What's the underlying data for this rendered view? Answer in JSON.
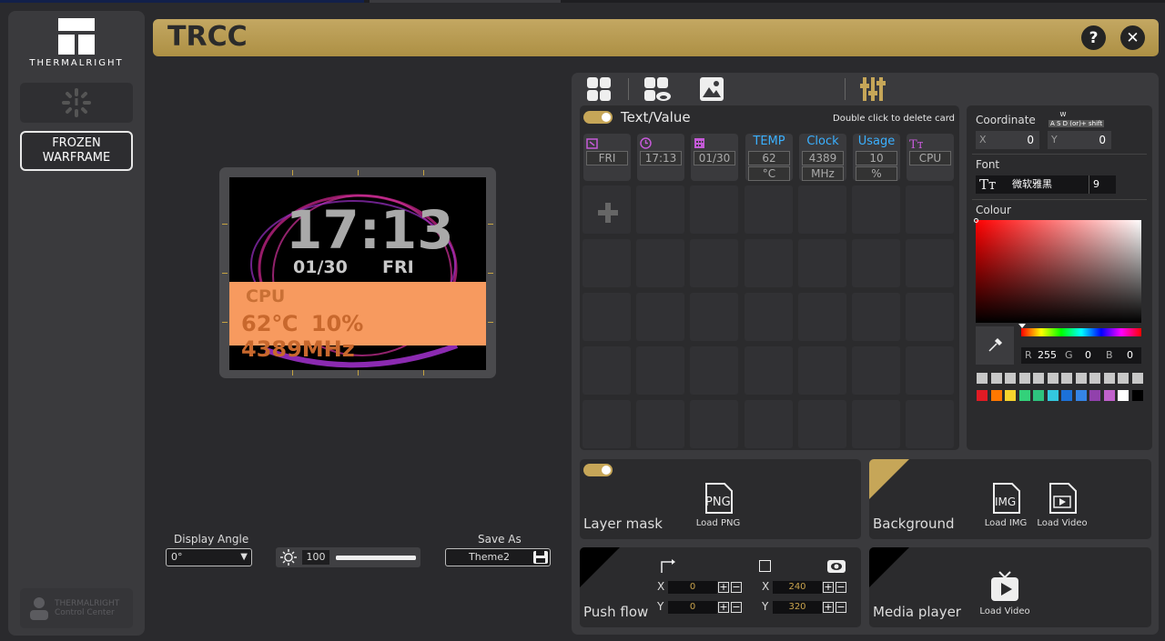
{
  "brand": {
    "name": "THERMALRIGHT"
  },
  "sidebar": {
    "device_button": "FROZEN\nWARFRAME",
    "control_center": {
      "line1": "THERMALRIGHT",
      "line2": "Control Center"
    }
  },
  "header": {
    "title": "TRCC",
    "help": "?",
    "close": "✕"
  },
  "preview": {
    "time": "17:13",
    "date": "01/30",
    "day": "FRI",
    "cpu_label": "CPU",
    "cpu_values": "62℃ 10% 4389MHz"
  },
  "controls": {
    "display_angle_label": "Display Angle",
    "display_angle_value": "0°",
    "brightness": "100",
    "brightness_level": 1.0,
    "save_as_label": "Save As",
    "save_as_value": "Theme2"
  },
  "cards_panel": {
    "title": "Text/Value",
    "hint": "Double click to delete card",
    "cards": [
      {
        "icon": "calendar-day-icon",
        "head": "",
        "value": "FRI",
        "unit": ""
      },
      {
        "icon": "clock-icon",
        "head": "",
        "value": "17:13",
        "unit": ""
      },
      {
        "icon": "calendar-grid-icon",
        "head": "",
        "value": "01/30",
        "unit": ""
      },
      {
        "icon": "",
        "head": "TEMP",
        "value": "62",
        "unit": "°C"
      },
      {
        "icon": "",
        "head": "Clock",
        "value": "4389",
        "unit": "MHz"
      },
      {
        "icon": "",
        "head": "Usage",
        "value": "10",
        "unit": "%"
      },
      {
        "icon": "text-icon",
        "head": "",
        "value": "CPU",
        "unit": ""
      }
    ]
  },
  "properties": {
    "coordinate_label": "Coordinate",
    "key_hint_top": "W",
    "key_hint": "A S D (or)+ shift",
    "x_label": "X",
    "x_value": "0",
    "y_label": "Y",
    "y_value": "0",
    "font_label": "Font",
    "font_name": "微软雅黑",
    "font_size": "9",
    "colour_label": "Colour",
    "r_label": "R",
    "r_value": "255",
    "g_label": "G",
    "g_value": "0",
    "b_label": "B",
    "b_value": "0",
    "grays": [
      "#c8c8c8",
      "#c8c8c8",
      "#c8c8c8",
      "#c8c8c8",
      "#c8c8c8",
      "#c8c8c8",
      "#c8c8c8",
      "#c8c8c8",
      "#c8c8c8",
      "#c8c8c8",
      "#c8c8c8",
      "#c8c8c8"
    ],
    "swatches": [
      "#e01b24",
      "#ff7800",
      "#f6d32d",
      "#33d17a",
      "#2ec27e",
      "#33c7de",
      "#1c71d8",
      "#3584e4",
      "#9141ac",
      "#c061cb",
      "#ffffff",
      "#000000"
    ]
  },
  "layer_mask": {
    "name": "Layer mask",
    "load_png": "Load PNG",
    "png_tag": "PNG"
  },
  "background": {
    "name": "Background",
    "load_img": "Load IMG",
    "load_video": "Load Video",
    "img_tag": "IMG"
  },
  "push_flow": {
    "name": "Push flow",
    "x1": "0",
    "y1": "0",
    "x2": "240",
    "y2": "320",
    "x_label": "X",
    "y_label": "Y"
  },
  "media_player": {
    "name": "Media player",
    "load_video": "Load Video"
  },
  "colors": {
    "accent": "#c6a658",
    "header": "#b99b50",
    "card_blue": "#3ab0ff"
  }
}
